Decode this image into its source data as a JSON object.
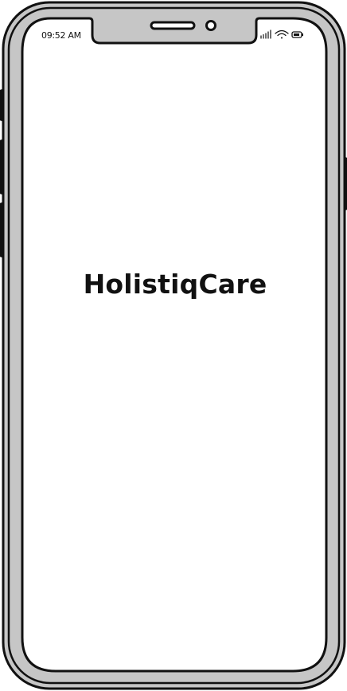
{
  "status_bar": {
    "time": "09:52 AM",
    "icons": [
      "signal-icon",
      "wifi-icon",
      "battery-icon"
    ]
  },
  "screen": {
    "app_title": "HolistiqCare"
  },
  "colors": {
    "frame_fill": "#c6c6c6",
    "outline": "#111111",
    "screen": "#ffffff"
  }
}
